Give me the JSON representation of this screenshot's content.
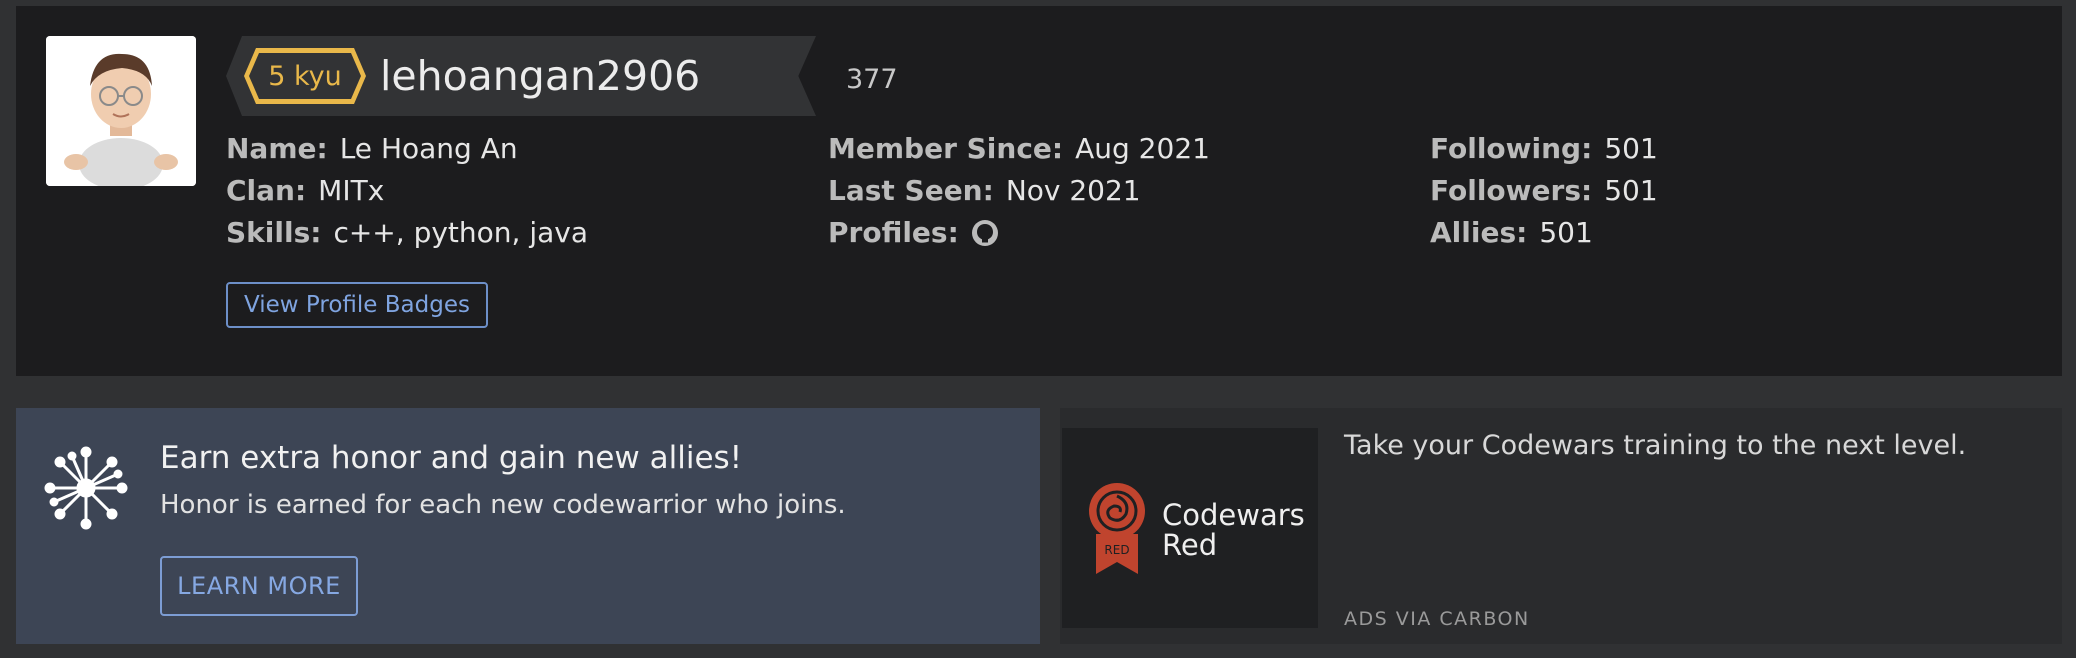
{
  "profile": {
    "rank": "5 kyu",
    "username": "lehoangan2906",
    "honor": "377",
    "left_info": [
      {
        "key": "Name:",
        "value": "Le Hoang An"
      },
      {
        "key": "Clan:",
        "value": "MITx"
      },
      {
        "key": "Skills:",
        "value": "c++, python, java"
      }
    ],
    "middle_info": [
      {
        "key": "Member Since:",
        "value": "Aug 2021"
      },
      {
        "key": "Last Seen:",
        "value": "Nov 2021"
      },
      {
        "key": "Profiles:",
        "icon": "github-icon"
      }
    ],
    "right_info": [
      {
        "key": "Following:",
        "value": "501"
      },
      {
        "key": "Followers:",
        "value": "501"
      },
      {
        "key": "Allies:",
        "value": "501"
      }
    ],
    "view_badges_label": "View Profile Badges"
  },
  "promo": {
    "title": "Earn extra honor and gain new allies!",
    "subtitle": "Honor is earned for each new codewarrior who joins.",
    "button_label": "LEARN MORE"
  },
  "ad": {
    "brand": "Codewars Red",
    "seal_label": "RED",
    "text": "Take your Codewars training to the next level.",
    "via": "ADS VIA CARBON"
  },
  "colors": {
    "rank": "#e9b84a",
    "link": "#7fa4e0",
    "seal": "#c0442e"
  }
}
